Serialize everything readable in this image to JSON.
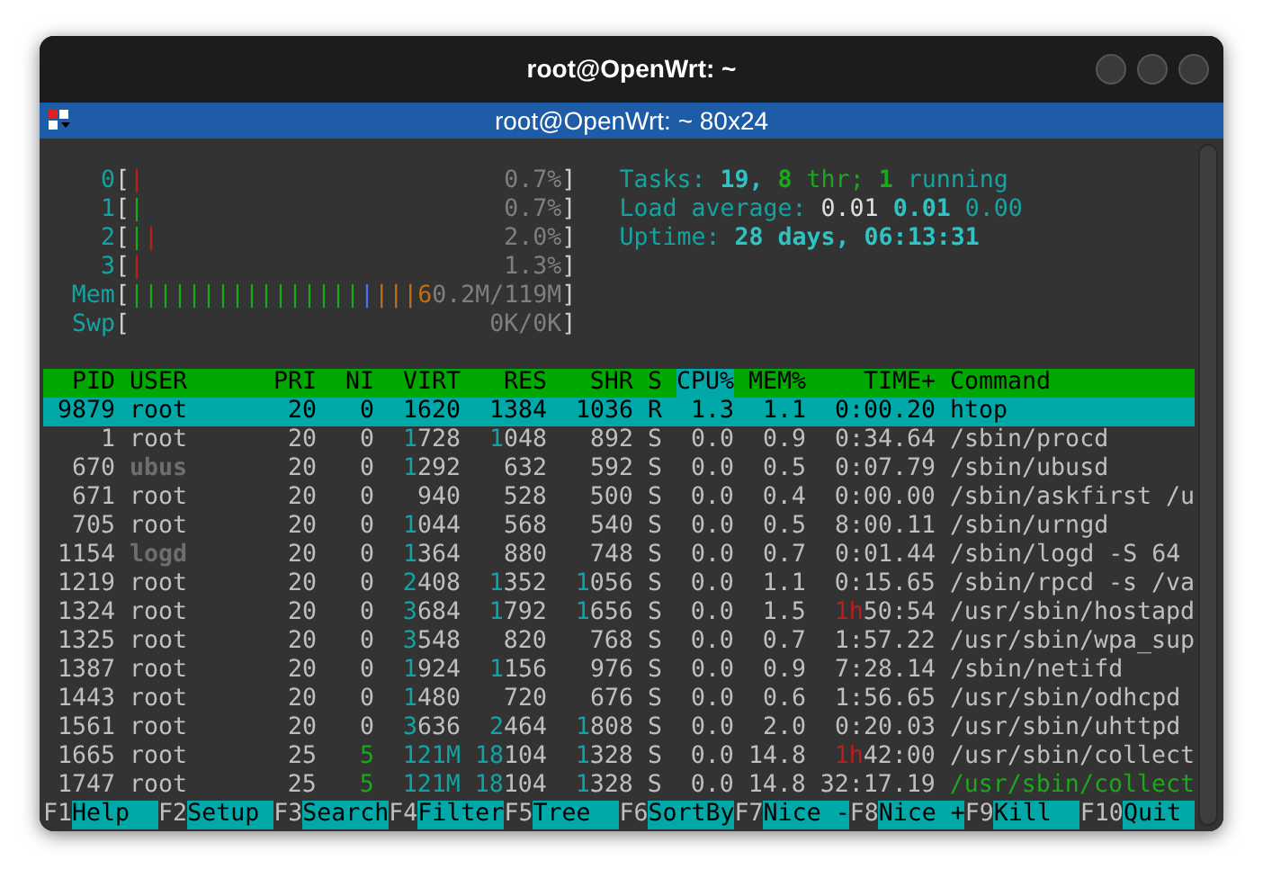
{
  "window": {
    "title": "root@OpenWrt: ~"
  },
  "tab": {
    "title": "root@OpenWrt: ~ 80x24"
  },
  "cpu_meters": [
    {
      "label": "0",
      "bracket_open": "[",
      "bar": [
        {
          "text": "|",
          "color": "#c01c1c"
        }
      ],
      "reading": "0.7%",
      "bracket_close": "]"
    },
    {
      "label": "1",
      "bracket_open": "[",
      "bar": [
        {
          "text": "|",
          "color": "#1ca81c"
        }
      ],
      "reading": "0.7%",
      "bracket_close": "]"
    },
    {
      "label": "2",
      "bracket_open": "[",
      "bar": [
        {
          "text": "|",
          "color": "#1ca81c"
        },
        {
          "text": "|",
          "color": "#c01c1c"
        }
      ],
      "reading": "2.0%",
      "bracket_close": "]"
    },
    {
      "label": "3",
      "bracket_open": "[",
      "bar": [
        {
          "text": "|",
          "color": "#c01c1c"
        }
      ],
      "reading": "1.3%",
      "bracket_close": "]"
    }
  ],
  "memory_meter": {
    "label": "Mem",
    "bracket_open": "[",
    "bar": [
      {
        "text": "||||||||||||||||",
        "color": "#1ca81c"
      },
      {
        "text": "|",
        "color": "#4a6cff"
      },
      {
        "text": "|||",
        "color": "#c07010"
      }
    ],
    "reading": "**6**0.2M/119M",
    "bracket_close": "]"
  },
  "swap_meter": {
    "label": "Swp",
    "bracket_open": "[",
    "reading": "0K/0K",
    "bracket_close": "]"
  },
  "tasks": {
    "label": "Tasks:",
    "count": "19,",
    "threads": "8",
    "threads_label": "thr;",
    "running": "1",
    "running_label": "running"
  },
  "load_average": {
    "label": "Load average:",
    "values": [
      "0.01",
      "0.01",
      "0.00"
    ]
  },
  "uptime": {
    "label": "Uptime:",
    "value": "28 days, 06:13:31"
  },
  "columns": [
    {
      "label": "PID",
      "selected": false
    },
    {
      "label": "USER",
      "selected": false
    },
    {
      "label": "PRI",
      "selected": false
    },
    {
      "label": "NI",
      "selected": false
    },
    {
      "label": "VIRT",
      "selected": false
    },
    {
      "label": "RES",
      "selected": false
    },
    {
      "label": "SHR",
      "selected": false
    },
    {
      "label": "S",
      "selected": false
    },
    {
      "label": "CPU%",
      "selected": true
    },
    {
      "label": "MEM%",
      "selected": false
    },
    {
      "label": "TIME+",
      "selected": false
    },
    {
      "label": "Command",
      "selected": false
    }
  ],
  "processes": [
    {
      "pid": "9879",
      "user": "root",
      "dimmed": false,
      "pri": "20",
      "ni": "0",
      "virt": "1620",
      "res": "1384",
      "shr": "1036",
      "s": "R",
      "cpu": "1.3",
      "mem": "1.1",
      "time": "0:00.20",
      "command": "htop",
      "thread": false,
      "selected": true
    },
    {
      "pid": "1",
      "user": "root",
      "dimmed": false,
      "pri": "20",
      "ni": "0",
      "virt": "**1**728",
      "res": "**1**048",
      "shr": "892",
      "s": "S",
      "cpu": "0.0",
      "mem": "0.9",
      "time": "0:34.64",
      "command": "/sbin/procd",
      "thread": false,
      "selected": false
    },
    {
      "pid": "670",
      "user": "ubus",
      "dimmed": true,
      "pri": "20",
      "ni": "0",
      "virt": "**1**292",
      "res": "632",
      "shr": "592",
      "s": "S",
      "cpu": "0.0",
      "mem": "0.5",
      "time": "0:07.79",
      "command": "/sbin/ubusd",
      "thread": false,
      "selected": false
    },
    {
      "pid": "671",
      "user": "root",
      "dimmed": false,
      "pri": "20",
      "ni": "0",
      "virt": "940",
      "res": "528",
      "shr": "500",
      "s": "S",
      "cpu": "0.0",
      "mem": "0.4",
      "time": "0:00.00",
      "command": "/sbin/askfirst /u",
      "thread": false,
      "selected": false
    },
    {
      "pid": "705",
      "user": "root",
      "dimmed": false,
      "pri": "20",
      "ni": "0",
      "virt": "**1**044",
      "res": "568",
      "shr": "540",
      "s": "S",
      "cpu": "0.0",
      "mem": "0.5",
      "time": "8:00.11",
      "command": "/sbin/urngd",
      "thread": false,
      "selected": false
    },
    {
      "pid": "1154",
      "user": "logd",
      "dimmed": true,
      "pri": "20",
      "ni": "0",
      "virt": "**1**364",
      "res": "880",
      "shr": "748",
      "s": "S",
      "cpu": "0.0",
      "mem": "0.7",
      "time": "0:01.44",
      "command": "/sbin/logd -S 64",
      "thread": false,
      "selected": false
    },
    {
      "pid": "1219",
      "user": "root",
      "dimmed": false,
      "pri": "20",
      "ni": "0",
      "virt": "**2**408",
      "res": "**1**352",
      "shr": "**1**056",
      "s": "S",
      "cpu": "0.0",
      "mem": "1.1",
      "time": "0:15.65",
      "command": "/sbin/rpcd -s /va",
      "thread": false,
      "selected": false
    },
    {
      "pid": "1324",
      "user": "root",
      "dimmed": false,
      "pri": "20",
      "ni": "0",
      "virt": "**3**684",
      "res": "**1**792",
      "shr": "**1**656",
      "s": "S",
      "cpu": "0.0",
      "mem": "1.5",
      "time": "**1h**50:54",
      "command": "/usr/sbin/hostapd",
      "thread": false,
      "selected": false
    },
    {
      "pid": "1325",
      "user": "root",
      "dimmed": false,
      "pri": "20",
      "ni": "0",
      "virt": "**3**548",
      "res": "820",
      "shr": "768",
      "s": "S",
      "cpu": "0.0",
      "mem": "0.7",
      "time": "1:57.22",
      "command": "/usr/sbin/wpa_sup",
      "thread": false,
      "selected": false
    },
    {
      "pid": "1387",
      "user": "root",
      "dimmed": false,
      "pri": "20",
      "ni": "0",
      "virt": "**1**924",
      "res": "**1**156",
      "shr": "976",
      "s": "S",
      "cpu": "0.0",
      "mem": "0.9",
      "time": "7:28.14",
      "command": "/sbin/netifd",
      "thread": false,
      "selected": false
    },
    {
      "pid": "1443",
      "user": "root",
      "dimmed": false,
      "pri": "20",
      "ni": "0",
      "virt": "**1**480",
      "res": "720",
      "shr": "676",
      "s": "S",
      "cpu": "0.0",
      "mem": "0.6",
      "time": "1:56.65",
      "command": "/usr/sbin/odhcpd",
      "thread": false,
      "selected": false
    },
    {
      "pid": "1561",
      "user": "root",
      "dimmed": false,
      "pri": "20",
      "ni": "0",
      "virt": "**3**636",
      "res": "**2**464",
      "shr": "**1**808",
      "s": "S",
      "cpu": "0.0",
      "mem": "2.0",
      "time": "0:20.03",
      "command": "/usr/sbin/uhttpd",
      "thread": false,
      "selected": false
    },
    {
      "pid": "1665",
      "user": "root",
      "dimmed": false,
      "pri": "25",
      "ni": "**5**",
      "virt": "**121M**",
      "res": "**18**104",
      "shr": "**1**328",
      "s": "S",
      "cpu": "0.0",
      "mem": "14.8",
      "time": "**1h**42:00",
      "command": "/usr/sbin/collect",
      "thread": false,
      "selected": false
    },
    {
      "pid": "1747",
      "user": "root",
      "dimmed": false,
      "pri": "25",
      "ni": "**5**",
      "virt": "**121M**",
      "res": "**18**104",
      "shr": "**1**328",
      "s": "S",
      "cpu": "0.0",
      "mem": "14.8",
      "time": "32:17.19",
      "command": "/usr/sbin/collect",
      "thread": true,
      "selected": false
    }
  ],
  "function_keys": [
    {
      "key": "F1",
      "label": "Help"
    },
    {
      "key": "F2",
      "label": "Setup"
    },
    {
      "key": "F3",
      "label": "Search"
    },
    {
      "key": "F4",
      "label": "Filter"
    },
    {
      "key": "F5",
      "label": "Tree"
    },
    {
      "key": "F6",
      "label": "SortBy"
    },
    {
      "key": "F7",
      "label": "Nice -"
    },
    {
      "key": "F8",
      "label": "Nice +"
    },
    {
      "key": "F9",
      "label": "Kill"
    },
    {
      "key": "F10",
      "label": "Quit"
    }
  ]
}
